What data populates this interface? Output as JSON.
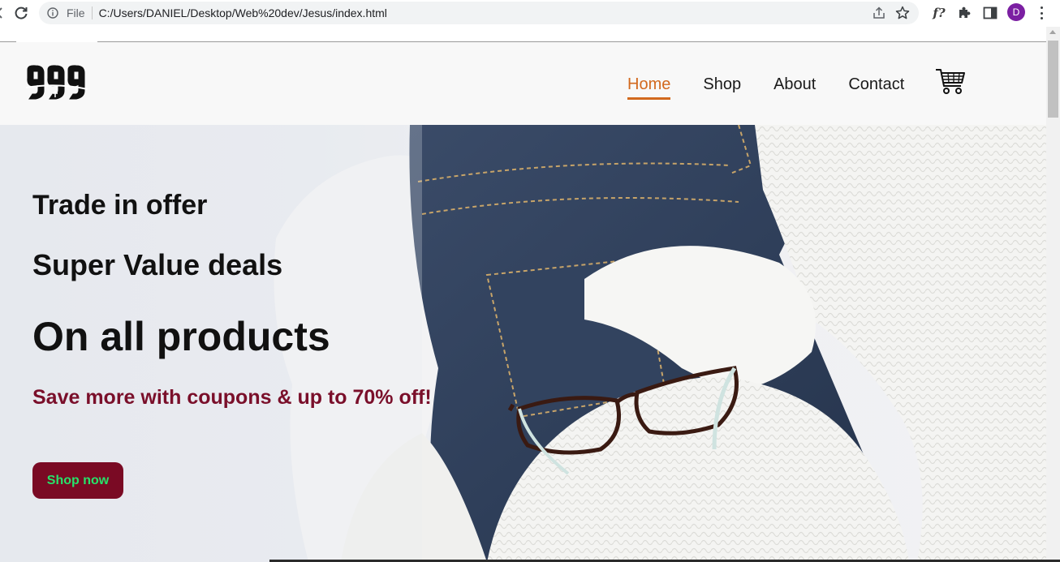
{
  "browser": {
    "scheme_label": "File",
    "url": "C:/Users/DANIEL/Desktop/Web%20dev/Jesus/index.html",
    "avatar_letter": "D",
    "extension_label": "f?"
  },
  "header": {
    "logo_alt": "999",
    "nav": [
      {
        "label": "Home",
        "active": true
      },
      {
        "label": "Shop",
        "active": false
      },
      {
        "label": "About",
        "active": false
      },
      {
        "label": "Contact",
        "active": false
      }
    ],
    "cart_icon": "cart-icon"
  },
  "hero": {
    "line1": "Trade in offer",
    "line2": "Super Value deals",
    "line3": "On all products",
    "promo": "Save more with coupons & up to 70% off!",
    "button": "Shop now"
  },
  "colors": {
    "nav_active": "#d2691e",
    "promo_text": "#7a0f2a",
    "button_bg": "#7a0a24",
    "button_text": "#26e36a"
  }
}
